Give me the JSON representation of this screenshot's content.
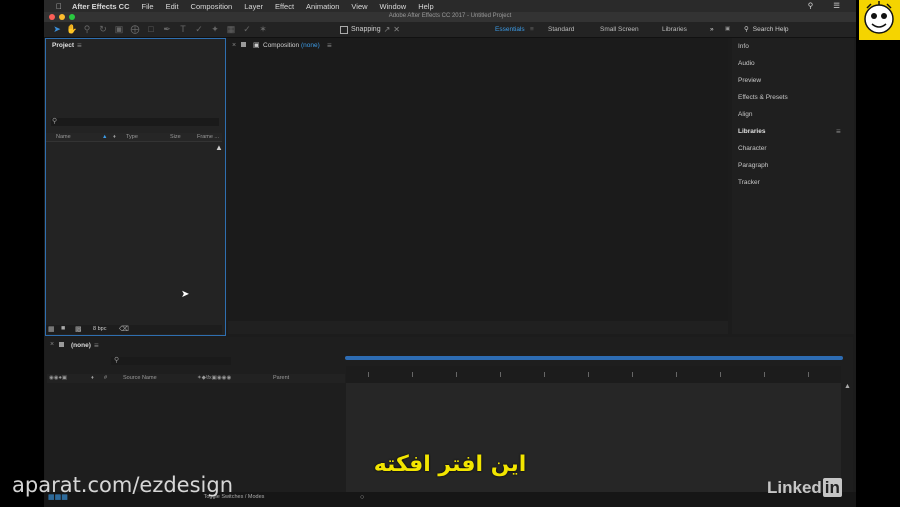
{
  "menubar": {
    "app_name": "After Effects CC",
    "items": [
      "File",
      "Edit",
      "Composition",
      "Layer",
      "Effect",
      "Animation",
      "View",
      "Window",
      "Help"
    ],
    "right_icons": [
      "search-icon",
      "menu-list-icon"
    ]
  },
  "window": {
    "title": "Adobe After Effects CC 2017 - Untitled Project"
  },
  "toolbar": {
    "snapping_label": "Snapping",
    "workspaces": [
      "Essentials",
      "Standard",
      "Small Screen",
      "Libraries"
    ],
    "active_workspace": "Essentials",
    "search_help_placeholder": "Search Help"
  },
  "project_panel": {
    "title": "Project",
    "columns": [
      "Name",
      "Type",
      "Size",
      "Frame ..."
    ],
    "bit_depth": "8 bpc"
  },
  "composition_panel": {
    "title": "Composition",
    "comp_name": "(none)"
  },
  "right_panel": {
    "items": [
      "Info",
      "Audio",
      "Preview",
      "Effects & Presets",
      "Align",
      "Libraries",
      "Character",
      "Paragraph",
      "Tracker"
    ],
    "bold_item": "Libraries"
  },
  "timeline": {
    "comp_name": "(none)",
    "columns": [
      "#",
      "Source Name",
      "Parent"
    ],
    "toggle_label": "Toggle Switches / Modes"
  },
  "overlay": {
    "subtitle": "این افتر افکته",
    "watermark": "aparat.com/ezdesign",
    "brand_linked": "Linked",
    "brand_in": "in"
  },
  "colors": {
    "accent": "#2f6fb0",
    "subtitle": "#f2e500",
    "logo_bg": "#f5d400"
  }
}
